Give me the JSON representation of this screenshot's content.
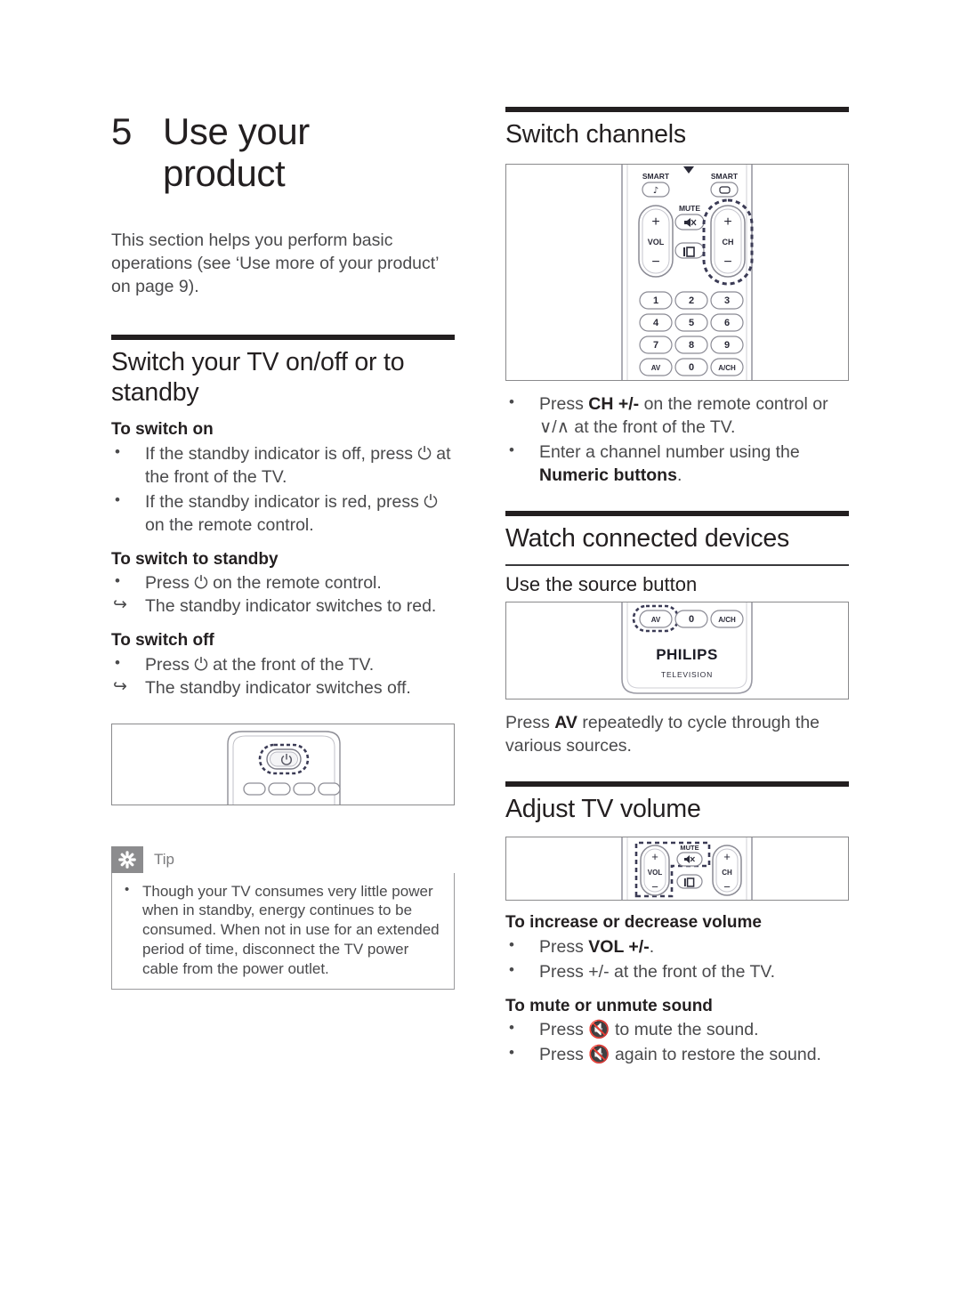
{
  "chapter": {
    "number": "5",
    "title": "Use your\nproduct",
    "intro": "This section helps you perform basic operations (see ‘Use more of your product’ on page 9)."
  },
  "left": {
    "section1": {
      "heading": "Switch your TV on/off or to standby",
      "sub1": "To switch on",
      "bullets1": [
        "If the standby indicator is off, press ⏻ at the front of the TV.",
        "If the standby indicator is red, press ⏻ on the remote control."
      ],
      "sub2": "To switch to standby",
      "bullets2": [
        "Press ⏻ on the remote control."
      ],
      "result2": "The standby indicator switches to red.",
      "sub3": "To switch off",
      "bullets3": [
        "Press ⏻ at the front of the TV."
      ],
      "result3": "The standby indicator switches off.",
      "figure_name": "tv-front-panel-power-button"
    },
    "tip": {
      "icon": "asterisk-icon",
      "label": "Tip",
      "items": [
        "Though your TV consumes very little power when in standby, energy continues to be consumed. When not in use for an extended period of time, disconnect the TV power cable from the power outlet."
      ]
    }
  },
  "right": {
    "switch_channels": {
      "heading": "Switch channels",
      "figure_name": "remote-control-channel-buttons",
      "bullets": [
        {
          "pre": "Press ",
          "bold": "CH +/-",
          "post": " on the remote control or ∨/∧ at the front of the TV."
        },
        {
          "pre": "Enter a channel number using the ",
          "bold": "Numeric buttons",
          "post": "."
        }
      ]
    },
    "watch_connected": {
      "heading": "Watch connected devices",
      "sub": "Use the source button",
      "figure_name": "remote-control-av-source-button",
      "para_pre": "Press ",
      "para_bold": "AV",
      "para_post": " repeatedly to cycle through the various sources."
    },
    "adjust_volume": {
      "heading": "Adjust TV volume",
      "figure_name": "remote-control-volume-mute-buttons",
      "sub1": "To increase or decrease volume",
      "bullets1": [
        {
          "pre": "Press ",
          "bold": "VOL +/-",
          "post": "."
        },
        {
          "pre": "Press ",
          "bold": "+/-",
          "post": " at the front of the TV."
        }
      ],
      "sub2": "To mute or unmute sound",
      "bullets2": [
        "Press 🔇 to mute the sound.",
        "Press 🔇 again to restore the sound."
      ]
    }
  },
  "remote": {
    "brand": "PHILIPS",
    "brand_sub": "TELEVISION",
    "labels": {
      "smart_left": "SMART",
      "smart_right": "SMART",
      "vol": "VOL",
      "ch": "CH",
      "mute": "MUTE",
      "plus": "+",
      "minus": "−"
    },
    "keys": [
      "1",
      "2",
      "3",
      "4",
      "5",
      "6",
      "7",
      "8",
      "9",
      "AV",
      "0",
      "A/CH"
    ]
  },
  "colors": {
    "rule": "#231f20",
    "text": "#4a4a4c",
    "heading": "#231f20",
    "tip_tab": "#8c8c8e",
    "figure_border": "#8a8a8c",
    "device_line": "#6b6b75",
    "highlight_dash": "#3b3b55"
  }
}
